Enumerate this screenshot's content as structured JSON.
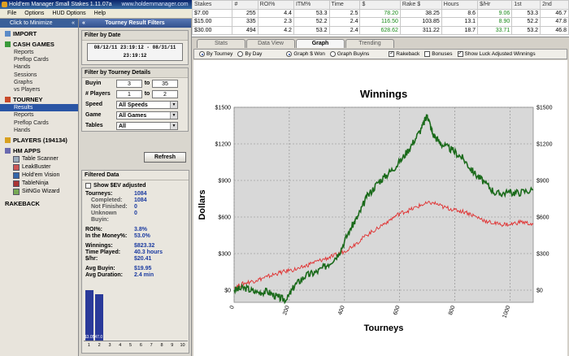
{
  "app": {
    "title": "Hold'em Manager Small Stakes 1.11.07a",
    "url": "www.holdemmanager.com"
  },
  "menu": [
    "File",
    "Options",
    "HUD Options",
    "Help"
  ],
  "sidebar": {
    "minimize_label": "Click to Minimize",
    "collapse_glyph": "«",
    "import": "IMPORT",
    "cash_games": "CASH GAMES",
    "cash_items": [
      "Reports",
      "Preflop Cards",
      "Hands",
      "Sessions",
      "Graphs",
      "vs Players"
    ],
    "tourney": "TOURNEY",
    "tourney_items": [
      "Results",
      "Reports",
      "Preflop Cards",
      "Hands"
    ],
    "players": "PLAYERS (194134)",
    "hm_apps": "HM APPS",
    "apps": [
      "Table Scanner",
      "LeakBuster",
      "Hold'em Vision",
      "TableNinja",
      "SitNGo Wizard"
    ],
    "rakeback": "RAKEBACK"
  },
  "filters": {
    "title": "Tourney Result Filters",
    "by_date_h": "Filter by Date",
    "date_range": "08/12/11 23:19:12 - 08/31/11 23:19:12",
    "by_details_h": "Filter by Tourney Details",
    "buyin_label": "Buyin",
    "buyin_from": "3",
    "buyin_to": "35",
    "players_label": "# Players",
    "players_from": "1",
    "players_to": "2",
    "to_label": "to",
    "speed_label": "Speed",
    "speed_value": "All Speeds",
    "game_label": "Game",
    "game_value": "All Games",
    "tables_label": "Tables",
    "tables_value": "All",
    "refresh": "Refresh"
  },
  "filtered": {
    "h": "Filtered Data",
    "show_sev": "Show $EV adjusted",
    "tourneys_k": "Tourneys:",
    "tourneys_v": "1084",
    "completed_k": "Completed:",
    "completed_v": "1084",
    "notfinished_k": "Not Finished:",
    "notfinished_v": "0",
    "unknown_k": "Unknown Buyin:",
    "unknown_v": "0",
    "roi_k": "ROI%:",
    "roi_v": "3.8%",
    "itm_k": "In the Money%:",
    "itm_v": "53.0%",
    "winnings_k": "Winnings:",
    "winnings_v": "$823.32",
    "time_k": "Time Played:",
    "time_v": "40.3 hours",
    "hr_k": "$/hr:",
    "hr_v": "$20.41",
    "avgbuyin_k": "Avg Buyin:",
    "avgbuyin_v": "$19.95",
    "avgdur_k": "Avg Duration:",
    "avgdur_v": "2.4 min",
    "mini_bars": [
      {
        "label": "$3.0",
        "value": 1
      },
      {
        "label": "$47.0",
        "value": 0.92
      }
    ],
    "mini_axis": [
      "1",
      "2",
      "3",
      "4",
      "5",
      "6",
      "7",
      "8",
      "9",
      "10"
    ]
  },
  "stats_table": {
    "headers": [
      "Stakes",
      "#",
      "ROI%",
      "ITM%",
      "Time",
      "$",
      "Rake $",
      "Hours",
      "$/Hr",
      "1st",
      "2nd"
    ],
    "rows": [
      [
        "$7.00",
        "255",
        "4.4",
        "53.3",
        "2.5",
        "78.20",
        "38.25",
        "8.6",
        "9.06",
        "53.3",
        "46.7"
      ],
      [
        "$15.00",
        "335",
        "2.3",
        "52.2",
        "2.4",
        "116.50",
        "103.85",
        "13.1",
        "8.90",
        "52.2",
        "47.8"
      ],
      [
        "$30.00",
        "494",
        "4.2",
        "53.2",
        "2.4",
        "628.62",
        "311.22",
        "18.7",
        "33.71",
        "53.2",
        "46.8"
      ]
    ]
  },
  "tabs": [
    "Stats",
    "Data View",
    "Graph",
    "Trending"
  ],
  "graph_options": {
    "by_tourney": "By Tourney",
    "by_day": "By Day",
    "graph_won": "Graph $ Won",
    "graph_buyins": "Graph Buyins",
    "rakeback": "Rakeback",
    "bonuses": "Bonuses",
    "luck": "Show Luck Adjusted Winnings"
  },
  "colors": {
    "won": "#1a6a1a",
    "luck": "#e03030",
    "accent": "#2a55a5"
  },
  "chart_data": {
    "type": "line",
    "title": "Winnings",
    "xlabel": "Tourneys",
    "ylabel": "Dollars",
    "xlim": [
      0,
      1084
    ],
    "ylim": [
      -100,
      1500
    ],
    "x_ticks": [
      0,
      200,
      400,
      600,
      800,
      1000
    ],
    "y_ticks": [
      0,
      300,
      600,
      900,
      1200,
      1500
    ],
    "y_tick_labels": [
      "$0",
      "$300",
      "$600",
      "$900",
      "$1200",
      "$1500"
    ],
    "grid": true,
    "series": [
      {
        "name": "won",
        "color": "#1a6a1a",
        "x": [
          0,
          40,
          80,
          120,
          160,
          190,
          220,
          260,
          300,
          340,
          380,
          420,
          450,
          480,
          520,
          560,
          600,
          640,
          680,
          700,
          720,
          750,
          790,
          830,
          870,
          910,
          950,
          990,
          1030,
          1084
        ],
        "y": [
          0,
          20,
          -20,
          -10,
          -60,
          -80,
          40,
          120,
          150,
          210,
          300,
          500,
          610,
          760,
          880,
          960,
          1050,
          1180,
          1330,
          1440,
          1280,
          1200,
          1150,
          1080,
          960,
          880,
          790,
          800,
          800,
          823
        ]
      },
      {
        "name": "luck",
        "color": "#e03030",
        "x": [
          0,
          40,
          80,
          120,
          160,
          200,
          240,
          280,
          320,
          360,
          400,
          440,
          480,
          520,
          560,
          600,
          640,
          680,
          720,
          760,
          800,
          840,
          880,
          920,
          960,
          1000,
          1040,
          1084
        ],
        "y": [
          20,
          60,
          80,
          110,
          140,
          160,
          180,
          220,
          250,
          280,
          320,
          380,
          450,
          510,
          570,
          630,
          660,
          700,
          720,
          680,
          660,
          640,
          600,
          560,
          540,
          540,
          560,
          540
        ]
      }
    ]
  }
}
